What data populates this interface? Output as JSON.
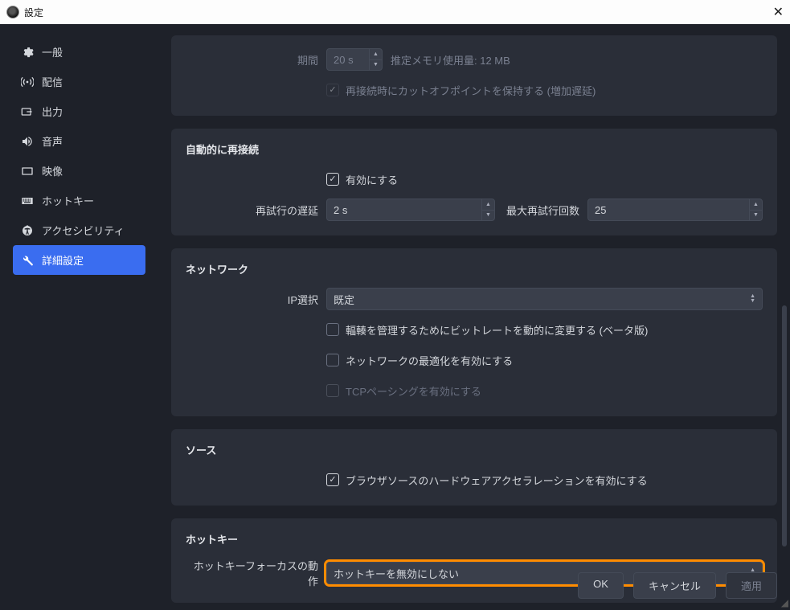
{
  "window": {
    "title": "設定"
  },
  "sidebar": {
    "items": [
      {
        "label": "一般"
      },
      {
        "label": "配信"
      },
      {
        "label": "出力"
      },
      {
        "label": "音声"
      },
      {
        "label": "映像"
      },
      {
        "label": "ホットキー"
      },
      {
        "label": "アクセシビリティ"
      },
      {
        "label": "詳細設定"
      }
    ]
  },
  "sections": {
    "top": {
      "duration_label": "期間",
      "duration_value": "20 s",
      "mem_label": "推定メモリ使用量: 12 MB",
      "keep_cutoff_label": "再接続時にカットオフポイントを保持する (増加遅延)"
    },
    "reconnect": {
      "title": "自動的に再接続",
      "enable_label": "有効にする",
      "retry_delay_label": "再試行の遅延",
      "retry_delay_value": "2 s",
      "max_retries_label": "最大再試行回数",
      "max_retries_value": "25"
    },
    "network": {
      "title": "ネットワーク",
      "ip_label": "IP選択",
      "ip_value": "既定",
      "bitrate_label": "輻輳を管理するためにビットレートを動的に変更する (ベータ版)",
      "optimize_label": "ネットワークの最適化を有効にする",
      "tcp_pacing_label": "TCPペーシングを有効にする"
    },
    "source": {
      "title": "ソース",
      "browser_hw_label": "ブラウザソースのハードウェアアクセラレーションを有効にする"
    },
    "hotkey": {
      "title": "ホットキー",
      "focus_label": "ホットキーフォーカスの動作",
      "focus_value": "ホットキーを無効にしない"
    }
  },
  "buttons": {
    "ok": "OK",
    "cancel": "キャンセル",
    "apply": "適用"
  }
}
